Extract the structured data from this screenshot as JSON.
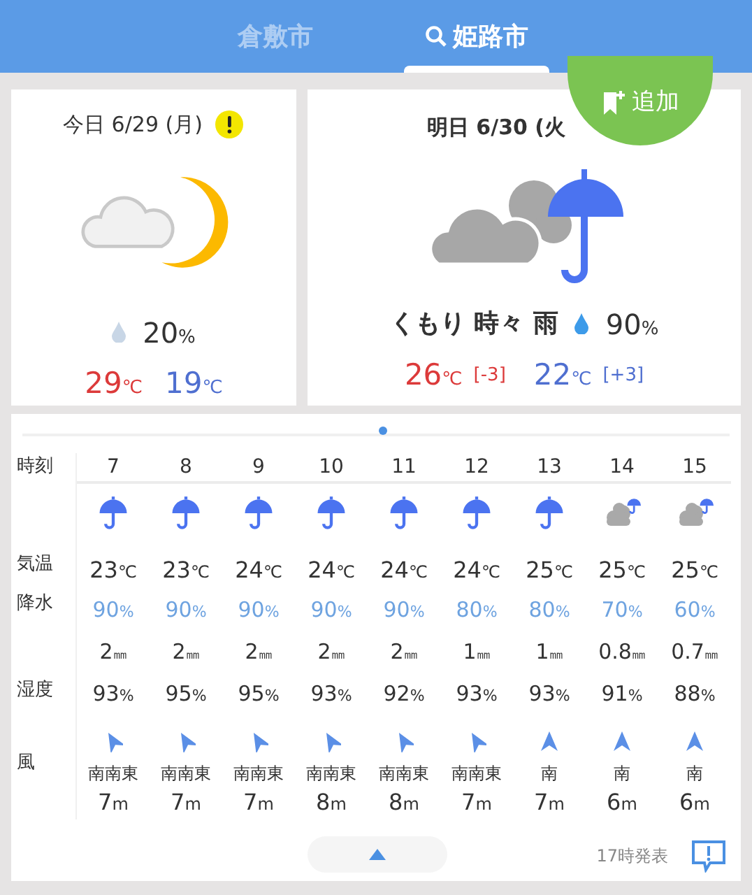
{
  "tabs": [
    {
      "label": "倉敷市",
      "selected": false,
      "search_icon": false
    },
    {
      "label": "姫路市",
      "selected": true,
      "search_icon": true
    }
  ],
  "add_button": {
    "label": "追加"
  },
  "today": {
    "date": "今日 6/29 (月)",
    "warning": true,
    "kind": "cloud_moon",
    "pop": "20%",
    "high": "29℃",
    "low": "19℃"
  },
  "tomorrow": {
    "date": "明日 6/30 (火",
    "kind": "cloud_rain",
    "weather": "くもり 時々 雨",
    "pop": "90%",
    "high": "26℃",
    "high_diff": "[-3]",
    "low": "22℃",
    "low_diff": "[+3]"
  },
  "hourly": {
    "labels": {
      "time": "時刻",
      "temp": "気温",
      "pop": "降水",
      "humidity": "湿度",
      "wind": "風"
    },
    "hours": [
      {
        "hour": "7",
        "kind": "rain",
        "temp": "23℃",
        "pop": "90%",
        "precip": "2㎜",
        "humidity": "93%",
        "wind_arrow": {
          "kind": "sse"
        },
        "wind": "南南東",
        "speed": "7m"
      },
      {
        "hour": "8",
        "kind": "rain",
        "temp": "23℃",
        "pop": "90%",
        "precip": "2㎜",
        "humidity": "95%",
        "wind_arrow": {
          "kind": "sse"
        },
        "wind": "南南東",
        "speed": "7m"
      },
      {
        "hour": "9",
        "kind": "rain",
        "temp": "24℃",
        "pop": "90%",
        "precip": "2㎜",
        "humidity": "95%",
        "wind_arrow": {
          "kind": "sse"
        },
        "wind": "南南東",
        "speed": "7m"
      },
      {
        "hour": "10",
        "kind": "rain",
        "temp": "24℃",
        "pop": "90%",
        "precip": "2㎜",
        "humidity": "93%",
        "wind_arrow": {
          "kind": "sse"
        },
        "wind": "南南東",
        "speed": "8m"
      },
      {
        "hour": "11",
        "kind": "rain",
        "temp": "24℃",
        "pop": "90%",
        "precip": "2㎜",
        "humidity": "92%",
        "wind_arrow": {
          "kind": "sse"
        },
        "wind": "南南東",
        "speed": "8m"
      },
      {
        "hour": "12",
        "kind": "rain",
        "temp": "24℃",
        "pop": "80%",
        "precip": "1㎜",
        "humidity": "93%",
        "wind_arrow": {
          "kind": "sse"
        },
        "wind": "南南東",
        "speed": "7m"
      },
      {
        "hour": "13",
        "kind": "rain",
        "temp": "25℃",
        "pop": "80%",
        "precip": "1㎜",
        "humidity": "93%",
        "wind_arrow": {
          "kind": "s"
        },
        "wind": "南",
        "speed": "7m"
      },
      {
        "hour": "14",
        "kind": "cloud_rain",
        "temp": "25℃",
        "pop": "70%",
        "precip": "0.8㎜",
        "humidity": "91%",
        "wind_arrow": {
          "kind": "s"
        },
        "wind": "南",
        "speed": "6m"
      },
      {
        "hour": "15",
        "kind": "cloud_rain",
        "temp": "25℃",
        "pop": "60%",
        "precip": "0.7㎜",
        "humidity": "88%",
        "wind_arrow": {
          "kind": "s"
        },
        "wind": "南",
        "speed": "6m"
      }
    ]
  },
  "footer": {
    "issued": "17時発表"
  }
}
